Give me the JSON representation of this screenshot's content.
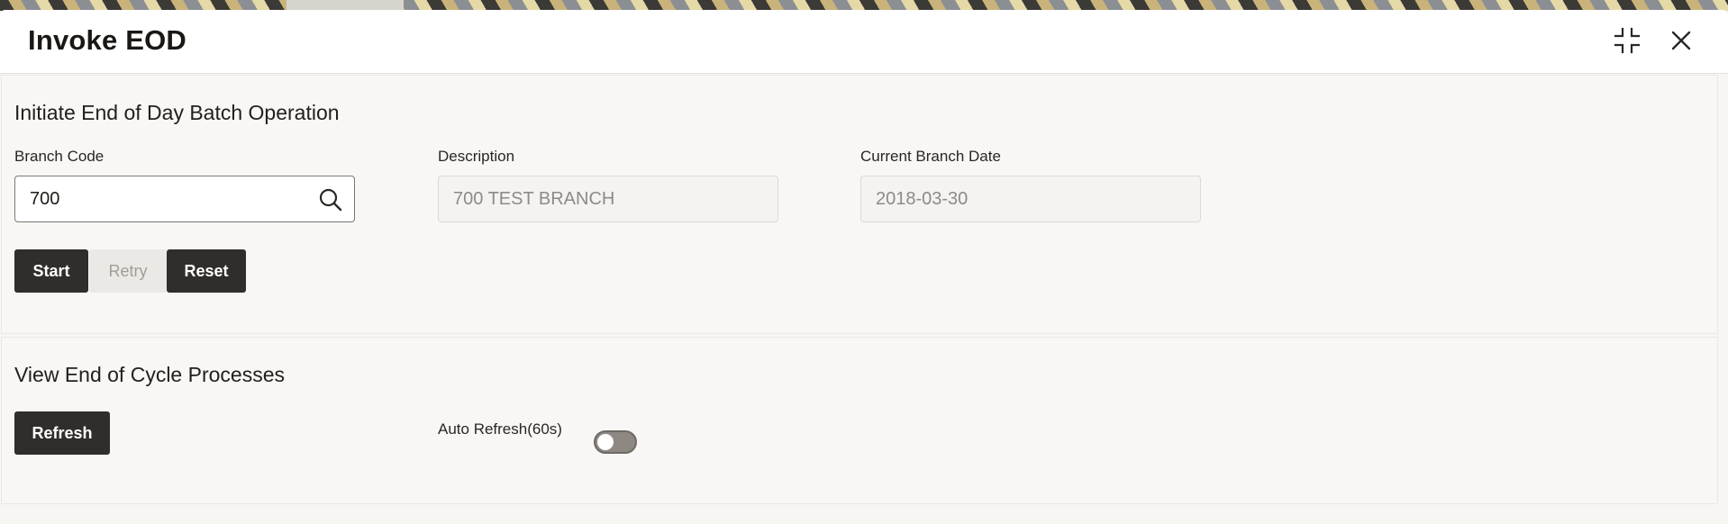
{
  "window": {
    "title": "Invoke EOD",
    "icons": [
      "minimize-icon",
      "close-icon"
    ]
  },
  "initiate_section": {
    "title": "Initiate End of Day Batch Operation",
    "branch_code": {
      "label": "Branch Code",
      "value": "700",
      "icon": "search-icon"
    },
    "description": {
      "label": "Description",
      "value": "700 TEST BRANCH"
    },
    "current_branch_date": {
      "label": "Current Branch Date",
      "value": "2018-03-30"
    },
    "buttons": {
      "start": "Start",
      "retry": "Retry",
      "reset": "Reset"
    }
  },
  "cycle_section": {
    "title": "View End of Cycle Processes",
    "refresh_label": "Refresh",
    "auto_refresh_label": "Auto Refresh(60s)",
    "auto_refresh_on": false
  },
  "colors": {
    "button_dark": "#312d2a",
    "background": "#f8f7f5"
  }
}
